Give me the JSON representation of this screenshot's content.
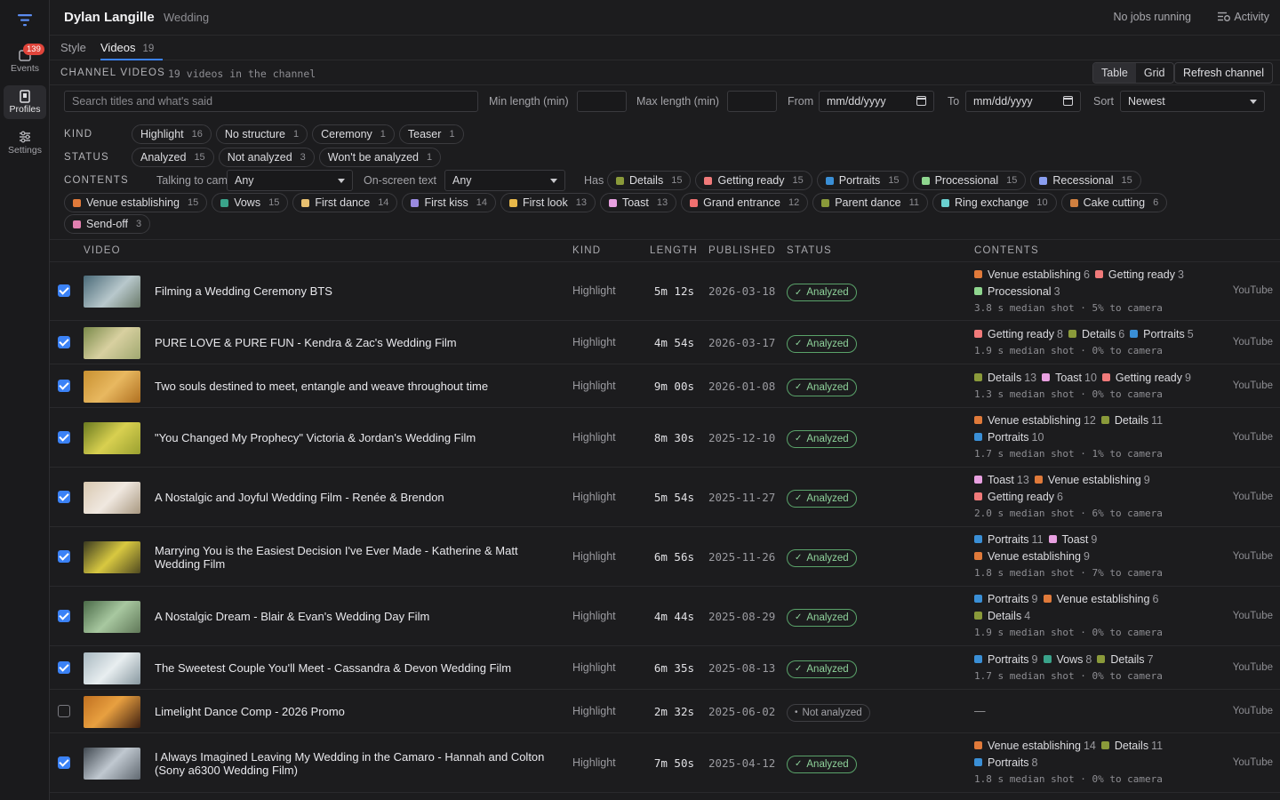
{
  "colors": {
    "accent": "#3b82f6",
    "analyzed": "#5aa36a",
    "badge": "#e0443a"
  },
  "sidebar": {
    "items": [
      {
        "label": "Events",
        "icon": "inbox-icon",
        "badge": "139"
      },
      {
        "label": "Profiles",
        "icon": "profile-card-icon"
      },
      {
        "label": "Settings",
        "icon": "sliders-icon"
      }
    ]
  },
  "header": {
    "title": "Dylan Langille",
    "subtitle": "Wedding",
    "jobs": "No jobs running",
    "activity": "Activity"
  },
  "tabs": [
    {
      "label": "Style",
      "count": ""
    },
    {
      "label": "Videos",
      "count": "19"
    }
  ],
  "section": {
    "label": "CHANNEL VIDEOS",
    "count": "19 videos in the channel",
    "view_table": "Table",
    "view_grid": "Grid",
    "refresh": "Refresh channel"
  },
  "filters": {
    "search_placeholder": "Search titles and what's said",
    "min_label": "Min length (min)",
    "max_label": "Max length (min)",
    "from_label": "From",
    "to_label": "To",
    "date_placeholder": "mm/dd/yyyy",
    "sort_label": "Sort",
    "sort_value": "Newest",
    "kind_label": "KIND",
    "status_label": "STATUS",
    "contents_label": "CONTENTS",
    "talking_label": "Talking to camera",
    "talking_value": "Any",
    "onscreen_label": "On-screen text",
    "onscreen_value": "Any",
    "has_label": "Has"
  },
  "kind_chips": [
    {
      "label": "Highlight",
      "count": "16"
    },
    {
      "label": "No structure",
      "count": "1"
    },
    {
      "label": "Ceremony",
      "count": "1"
    },
    {
      "label": "Teaser",
      "count": "1"
    }
  ],
  "status_chips": [
    {
      "label": "Analyzed",
      "count": "15"
    },
    {
      "label": "Not analyzed",
      "count": "3"
    },
    {
      "label": "Won't be analyzed",
      "count": "1"
    }
  ],
  "has_chips": [
    {
      "label": "Details",
      "count": "15",
      "color": "#8a9a3a"
    },
    {
      "label": "Getting ready",
      "count": "15",
      "color": "#f07a7a"
    },
    {
      "label": "Portraits",
      "count": "15",
      "color": "#3a8fd6"
    },
    {
      "label": "Processional",
      "count": "15",
      "color": "#8fd68f"
    },
    {
      "label": "Recessional",
      "count": "15",
      "color": "#8a9ef0"
    }
  ],
  "content_chips": [
    {
      "label": "Venue establishing",
      "count": "15",
      "color": "#e07a3a"
    },
    {
      "label": "Vows",
      "count": "15",
      "color": "#3aa38a"
    },
    {
      "label": "First dance",
      "count": "14",
      "color": "#e8c070"
    },
    {
      "label": "First kiss",
      "count": "14",
      "color": "#9a8ae0"
    },
    {
      "label": "First look",
      "count": "13",
      "color": "#e8b84a"
    },
    {
      "label": "Toast",
      "count": "13",
      "color": "#e8a0e0"
    },
    {
      "label": "Grand entrance",
      "count": "12",
      "color": "#f07070"
    },
    {
      "label": "Parent dance",
      "count": "11",
      "color": "#8a9a3a"
    },
    {
      "label": "Ring exchange",
      "count": "10",
      "color": "#6ad0d0"
    },
    {
      "label": "Cake cutting",
      "count": "6",
      "color": "#d08040"
    }
  ],
  "content_chips_row2": [
    {
      "label": "Send-off",
      "count": "3",
      "color": "#e080b0"
    }
  ],
  "table": {
    "headers": [
      "VIDEO",
      "KIND",
      "LENGTH",
      "PUBLISHED",
      "STATUS",
      "CONTENTS"
    ],
    "rows": [
      {
        "checked": true,
        "title": "Filming a Wedding Ceremony BTS",
        "kind": "Highlight",
        "length": "5m 12s",
        "published": "2026-03-18",
        "status": "Analyzed",
        "content_lines": [
          [
            {
              "label": "Venue establishing",
              "count": "6",
              "color": "#e07a3a"
            },
            {
              "label": "Getting ready",
              "count": "3",
              "color": "#f07a7a"
            }
          ],
          [
            {
              "label": "Processional",
              "count": "3",
              "color": "#8fd68f"
            }
          ]
        ],
        "meta": "3.8 s median shot · 5% to camera",
        "source": "YouTube"
      },
      {
        "checked": true,
        "title": "PURE LOVE & PURE FUN - Kendra & Zac's Wedding Film",
        "kind": "Highlight",
        "length": "4m 54s",
        "published": "2026-03-17",
        "status": "Analyzed",
        "content_lines": [
          [
            {
              "label": "Getting ready",
              "count": "8",
              "color": "#f07a7a"
            },
            {
              "label": "Details",
              "count": "6",
              "color": "#8a9a3a"
            },
            {
              "label": "Portraits",
              "count": "5",
              "color": "#3a8fd6"
            }
          ]
        ],
        "meta": "1.9 s median shot · 0% to camera",
        "source": "YouTube"
      },
      {
        "checked": true,
        "title": "Two souls destined to meet, entangle and weave throughout time",
        "kind": "Highlight",
        "length": "9m 00s",
        "published": "2026-01-08",
        "status": "Analyzed",
        "content_lines": [
          [
            {
              "label": "Details",
              "count": "13",
              "color": "#8a9a3a"
            },
            {
              "label": "Toast",
              "count": "10",
              "color": "#e8a0e0"
            },
            {
              "label": "Getting ready",
              "count": "9",
              "color": "#f07a7a"
            }
          ]
        ],
        "meta": "1.3 s median shot · 0% to camera",
        "source": "YouTube"
      },
      {
        "checked": true,
        "title": "\"You Changed My Prophecy\" Victoria & Jordan's Wedding Film",
        "kind": "Highlight",
        "length": "8m 30s",
        "published": "2025-12-10",
        "status": "Analyzed",
        "content_lines": [
          [
            {
              "label": "Venue establishing",
              "count": "12",
              "color": "#e07a3a"
            },
            {
              "label": "Details",
              "count": "11",
              "color": "#8a9a3a"
            }
          ],
          [
            {
              "label": "Portraits",
              "count": "10",
              "color": "#3a8fd6"
            }
          ]
        ],
        "meta": "1.7 s median shot · 1% to camera",
        "source": "YouTube"
      },
      {
        "checked": true,
        "title": "A Nostalgic and Joyful Wedding Film - Renée & Brendon",
        "kind": "Highlight",
        "length": "5m 54s",
        "published": "2025-11-27",
        "status": "Analyzed",
        "content_lines": [
          [
            {
              "label": "Toast",
              "count": "13",
              "color": "#e8a0e0"
            },
            {
              "label": "Venue establishing",
              "count": "9",
              "color": "#e07a3a"
            }
          ],
          [
            {
              "label": "Getting ready",
              "count": "6",
              "color": "#f07a7a"
            }
          ]
        ],
        "meta": "2.0 s median shot · 6% to camera",
        "source": "YouTube"
      },
      {
        "checked": true,
        "title": "Marrying You is the Easiest Decision I've Ever Made - Katherine & Matt Wedding Film",
        "kind": "Highlight",
        "length": "6m 56s",
        "published": "2025-11-26",
        "status": "Analyzed",
        "content_lines": [
          [
            {
              "label": "Portraits",
              "count": "11",
              "color": "#3a8fd6"
            },
            {
              "label": "Toast",
              "count": "9",
              "color": "#e8a0e0"
            }
          ],
          [
            {
              "label": "Venue establishing",
              "count": "9",
              "color": "#e07a3a"
            }
          ]
        ],
        "meta": "1.8 s median shot · 7% to camera",
        "source": "YouTube"
      },
      {
        "checked": true,
        "title": "A Nostalgic Dream - Blair & Evan's Wedding Day Film",
        "kind": "Highlight",
        "length": "4m 44s",
        "published": "2025-08-29",
        "status": "Analyzed",
        "content_lines": [
          [
            {
              "label": "Portraits",
              "count": "9",
              "color": "#3a8fd6"
            },
            {
              "label": "Venue establishing",
              "count": "6",
              "color": "#e07a3a"
            }
          ],
          [
            {
              "label": "Details",
              "count": "4",
              "color": "#8a9a3a"
            }
          ]
        ],
        "meta": "1.9 s median shot · 0% to camera",
        "source": "YouTube"
      },
      {
        "checked": true,
        "title": "The Sweetest Couple You'll Meet - Cassandra & Devon Wedding Film",
        "kind": "Highlight",
        "length": "6m 35s",
        "published": "2025-08-13",
        "status": "Analyzed",
        "content_lines": [
          [
            {
              "label": "Portraits",
              "count": "9",
              "color": "#3a8fd6"
            },
            {
              "label": "Vows",
              "count": "8",
              "color": "#3aa38a"
            },
            {
              "label": "Details",
              "count": "7",
              "color": "#8a9a3a"
            }
          ]
        ],
        "meta": "1.7 s median shot · 0% to camera",
        "source": "YouTube"
      },
      {
        "checked": false,
        "title": "Limelight Dance Comp - 2026 Promo",
        "kind": "Highlight",
        "length": "2m 32s",
        "published": "2025-06-02",
        "status": "Not analyzed",
        "content_lines": [],
        "meta": "",
        "empty": "—",
        "source": "YouTube"
      },
      {
        "checked": true,
        "title": "I Always Imagined Leaving My Wedding in the Camaro - Hannah and Colton (Sony a6300 Wedding Film)",
        "kind": "Highlight",
        "length": "7m 50s",
        "published": "2025-04-12",
        "status": "Analyzed",
        "content_lines": [
          [
            {
              "label": "Venue establishing",
              "count": "14",
              "color": "#e07a3a"
            },
            {
              "label": "Details",
              "count": "11",
              "color": "#8a9a3a"
            }
          ],
          [
            {
              "label": "Portraits",
              "count": "8",
              "color": "#3a8fd6"
            }
          ]
        ],
        "meta": "1.8 s median shot · 0% to camera",
        "source": "YouTube"
      }
    ]
  }
}
